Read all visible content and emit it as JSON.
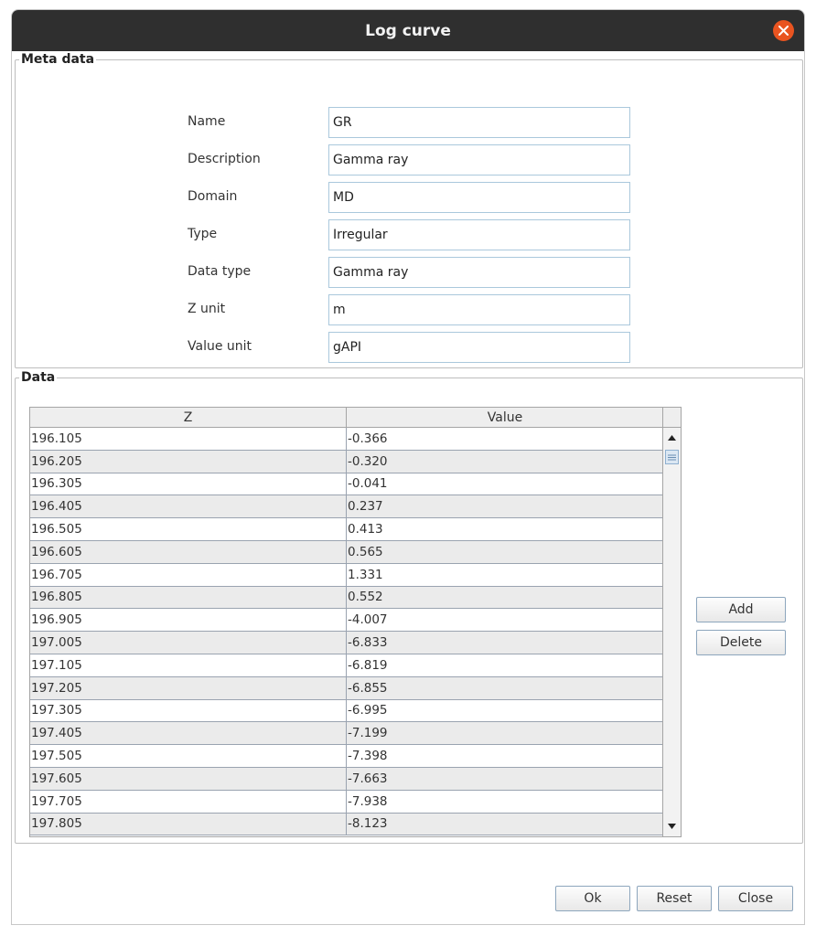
{
  "window": {
    "title": "Log curve"
  },
  "meta": {
    "legend": "Meta data",
    "fields": [
      {
        "label": "Name",
        "value": "GR"
      },
      {
        "label": "Description",
        "value": "Gamma ray"
      },
      {
        "label": "Domain",
        "value": "MD"
      },
      {
        "label": "Type",
        "value": "Irregular"
      },
      {
        "label": "Data type",
        "value": "Gamma ray"
      },
      {
        "label": "Z unit",
        "value": "m"
      },
      {
        "label": "Value unit",
        "value": "gAPI"
      }
    ]
  },
  "data": {
    "legend": "Data",
    "columns": [
      "Z",
      "Value"
    ],
    "rows": [
      [
        "196.105",
        "-0.366"
      ],
      [
        "196.205",
        "-0.320"
      ],
      [
        "196.305",
        "-0.041"
      ],
      [
        "196.405",
        "0.237"
      ],
      [
        "196.505",
        "0.413"
      ],
      [
        "196.605",
        "0.565"
      ],
      [
        "196.705",
        "1.331"
      ],
      [
        "196.805",
        "0.552"
      ],
      [
        "196.905",
        "-4.007"
      ],
      [
        "197.005",
        "-6.833"
      ],
      [
        "197.105",
        "-6.819"
      ],
      [
        "197.205",
        "-6.855"
      ],
      [
        "197.305",
        "-6.995"
      ],
      [
        "197.405",
        "-7.199"
      ],
      [
        "197.505",
        "-7.398"
      ],
      [
        "197.605",
        "-7.663"
      ],
      [
        "197.705",
        "-7.938"
      ],
      [
        "197.805",
        "-8.123"
      ]
    ],
    "add_label": "Add",
    "delete_label": "Delete"
  },
  "footer": {
    "ok_label": "Ok",
    "reset_label": "Reset",
    "close_label": "Close"
  },
  "icons": {
    "close": "close-icon",
    "scroll_up": "arrow-up-icon",
    "scroll_down": "arrow-down-icon"
  },
  "colors": {
    "titlebar": "#2f2f2f",
    "close_button": "#e95420",
    "input_border": "#aac8dc",
    "alt_row": "#ebebeb"
  }
}
